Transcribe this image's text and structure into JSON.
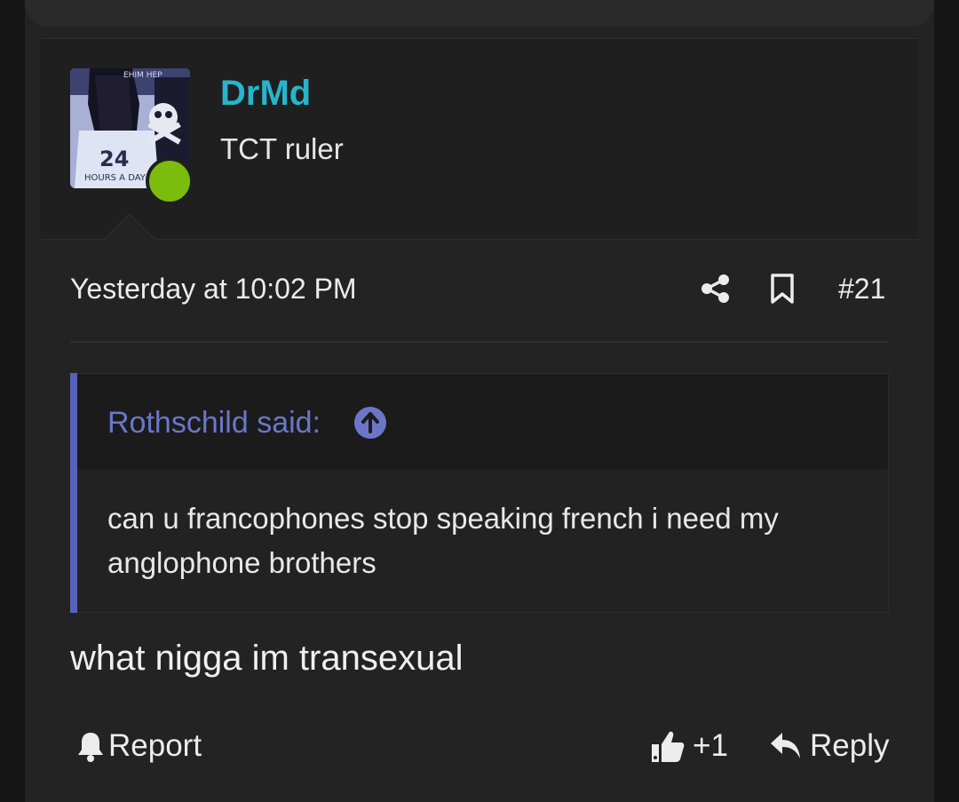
{
  "post": {
    "author": {
      "username": "DrMd",
      "user_title": "TCT ruler",
      "status": "online",
      "avatar_text": "24 HOURS A DAY"
    },
    "timestamp": "Yesterday at 10:02 PM",
    "post_number": "#21",
    "quote": {
      "author_label": "Rothschild said:",
      "text": "can u francophones stop speaking french i need my anglophone brothers"
    },
    "message": "what nigga im transexual",
    "actions": {
      "report_label": "Report",
      "like_count": "+1",
      "reply_label": "Reply"
    }
  },
  "icons": {
    "share": "share-icon",
    "bookmark": "bookmark-icon",
    "quote_jump": "arrow-up-circle-icon",
    "report": "bell-icon",
    "like": "thumbs-up-icon",
    "reply": "reply-arrow-icon"
  },
  "colors": {
    "username": "#27b4cd",
    "quote_accent": "#5863b8",
    "online": "#7bbc0c",
    "background": "#232323"
  }
}
